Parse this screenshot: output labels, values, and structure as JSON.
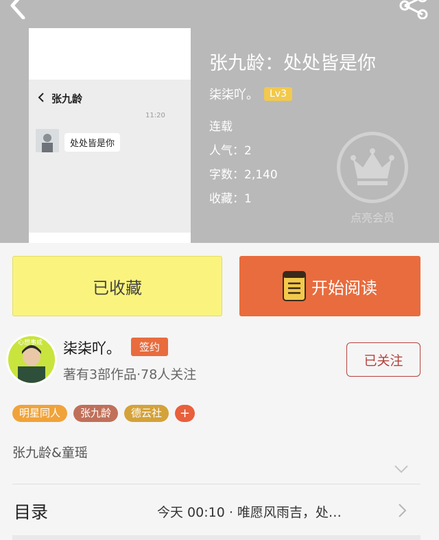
{
  "header": {
    "book_title": "张九龄：处处皆是你",
    "author": "柒柒吖。",
    "level": "Lv3",
    "status": "连载",
    "popularity": "人气：2",
    "word_count": "字数：2,140",
    "favorites": "收藏：1",
    "vip_label": "点亮会员"
  },
  "cover": {
    "chat_title": "张九龄",
    "time": "11:20",
    "message": "处处皆是你"
  },
  "actions": {
    "collected_label": "已收藏",
    "read_label": "开始阅读"
  },
  "author_section": {
    "name": "柒柒吖。",
    "sign_badge": "签约",
    "stats": "著有3部作品·78人关注",
    "follow_label": "已关注",
    "avatar_caption": "心想事成"
  },
  "tags": [
    {
      "label": "明星同人",
      "color": "#f0a33a"
    },
    {
      "label": "张九龄",
      "color": "#c0705a"
    },
    {
      "label": "德云社",
      "color": "#d4a23a"
    }
  ],
  "tag_add": "+",
  "description": "张九龄&童瑶",
  "toc": {
    "label": "目录",
    "latest": "今天 00:10 · 唯愿风雨吉，处…"
  },
  "colors": {
    "header_bg": "#b9b9b9",
    "collect_bg": "#faf47e",
    "read_bg": "#e86c3e",
    "follow_border": "#b3413c"
  }
}
